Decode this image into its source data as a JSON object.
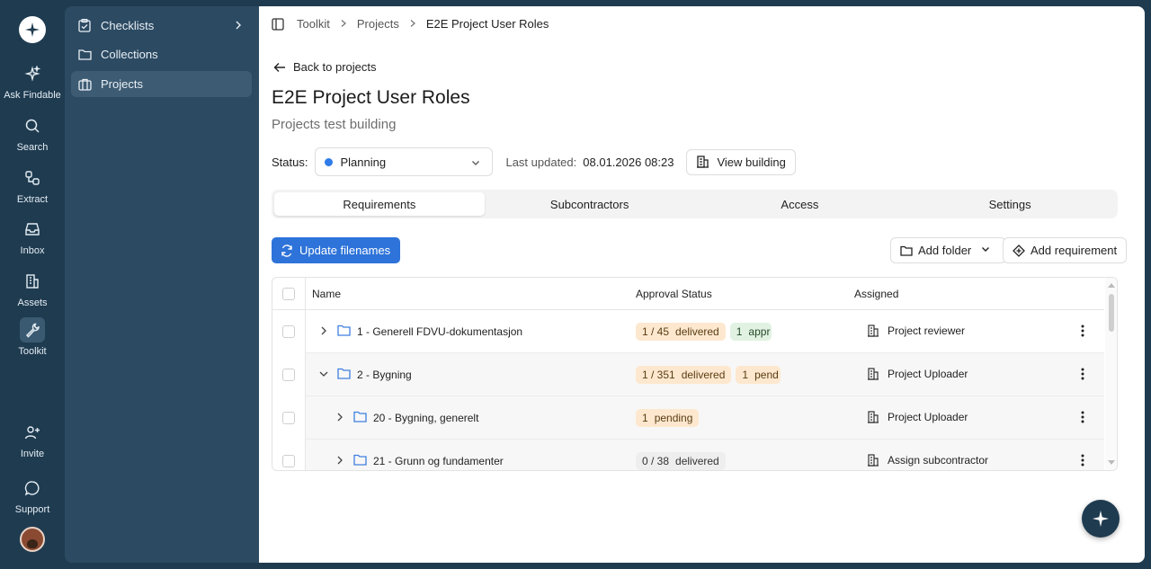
{
  "rail": {
    "items": [
      {
        "label": "Ask Findable",
        "icon": "sparkle-icon"
      },
      {
        "label": "Search",
        "icon": "search-icon"
      },
      {
        "label": "Extract",
        "icon": "extract-icon"
      },
      {
        "label": "Inbox",
        "icon": "inbox-icon"
      },
      {
        "label": "Assets",
        "icon": "building-icon"
      },
      {
        "label": "Toolkit",
        "icon": "wrench-icon"
      },
      {
        "label": "Invite",
        "icon": "user-plus-icon"
      },
      {
        "label": "Support",
        "icon": "chat-bubble-icon"
      }
    ],
    "active": "Toolkit"
  },
  "sidebar": {
    "items": [
      {
        "label": "Checklists",
        "icon": "clipboard-check-icon"
      },
      {
        "label": "Collections",
        "icon": "folder-icon"
      },
      {
        "label": "Projects",
        "icon": "projects-icon"
      }
    ],
    "active": "Projects"
  },
  "breadcrumb": {
    "items": [
      "Toolkit",
      "Projects",
      "E2E Project User Roles"
    ]
  },
  "back_label": "Back to projects",
  "page": {
    "title": "E2E Project User Roles",
    "subtitle": "Projects test building"
  },
  "status": {
    "label": "Status:",
    "value": "Planning",
    "dot_color": "#2f7be8",
    "last_updated_label": "Last updated:",
    "last_updated_value": "08.01.2026 08:23",
    "view_building_label": "View building"
  },
  "tabs": [
    {
      "label": "Requirements",
      "active": true
    },
    {
      "label": "Subcontractors",
      "active": false
    },
    {
      "label": "Access",
      "active": false
    },
    {
      "label": "Settings",
      "active": false
    }
  ],
  "actions": {
    "update_filenames": "Update filenames",
    "add_folder": "Add folder",
    "add_requirement": "Add requirement"
  },
  "table": {
    "columns": {
      "name": "Name",
      "approval": "Approval Status",
      "assigned": "Assigned"
    },
    "rows": [
      {
        "name": "1 - Generell FDVU-dokumentasjon",
        "expanded": false,
        "indent": 0,
        "badges": [
          {
            "num": "1 / 45",
            "text": "delivered",
            "tone": "orange"
          },
          {
            "num": "1",
            "text": "appr",
            "tone": "green"
          }
        ],
        "assigned": "Project reviewer"
      },
      {
        "name": "2 - Bygning",
        "expanded": true,
        "indent": 0,
        "badges": [
          {
            "num": "1 / 351",
            "text": "delivered",
            "tone": "orange"
          },
          {
            "num": "1",
            "text": "pend",
            "tone": "orange"
          }
        ],
        "assigned": "Project Uploader"
      },
      {
        "name": "20 - Bygning, generelt",
        "expanded": false,
        "indent": 1,
        "badges": [
          {
            "num": "1",
            "text": "pending",
            "tone": "orange"
          }
        ],
        "assigned": "Project Uploader"
      },
      {
        "name": "21 - Grunn og fundamenter",
        "expanded": false,
        "indent": 1,
        "badges": [
          {
            "num": "0 / 38",
            "text": "delivered",
            "tone": "gray"
          }
        ],
        "assigned": "Assign subcontractor"
      }
    ]
  },
  "colors": {
    "rail_bg": "#1f3b50",
    "sidebar_bg": "#2c4a62",
    "primary": "#2d73d9",
    "badge_orange": "#fde8cf",
    "badge_green": "#e1f2e2",
    "badge_gray": "#eeeeee"
  }
}
